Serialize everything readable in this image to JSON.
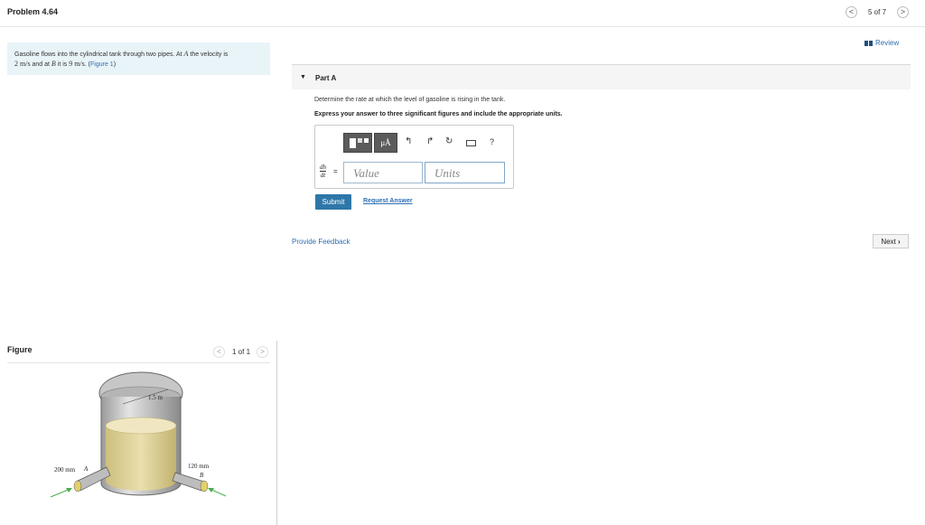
{
  "header": {
    "title": "Problem 4.64",
    "pager": "5 of 7",
    "prev_glyph": "<",
    "next_glyph": ">",
    "review": "Review"
  },
  "problem": {
    "text_1": "Gasoline flows into the cylindrical tank through two pipes. At ",
    "point_a": "A",
    "text_2": " the velocity is",
    "velocity_a": "2 m/s",
    "text_3": " and at ",
    "point_b": "B",
    "text_4": " it is ",
    "velocity_b": "9 m/s",
    "text_5": ". (",
    "figure_link": "Figure 1",
    "text_6": ")"
  },
  "part_a": {
    "label": "Part A",
    "question": "Determine the rate at which the level of gasoline is rising in the tank.",
    "instruction": "Express your answer to three significant figures and include the appropriate units.",
    "lhs_num": "dh",
    "lhs_den": "dt",
    "equals": "=",
    "value_placeholder": "Value",
    "units_placeholder": "Units",
    "units_tool": "μÅ",
    "help": "?",
    "submit": "Submit",
    "request_answer": "Request Answer"
  },
  "footer": {
    "feedback": "Provide Feedback",
    "next": "Next"
  },
  "figure": {
    "title": "Figure",
    "pager": "1 of 1",
    "diameter_label": "1.5 m",
    "pipe_a_label": "200 mm",
    "pipe_a_point": "A",
    "pipe_b_label": "120 mm",
    "pipe_b_point": "B"
  }
}
